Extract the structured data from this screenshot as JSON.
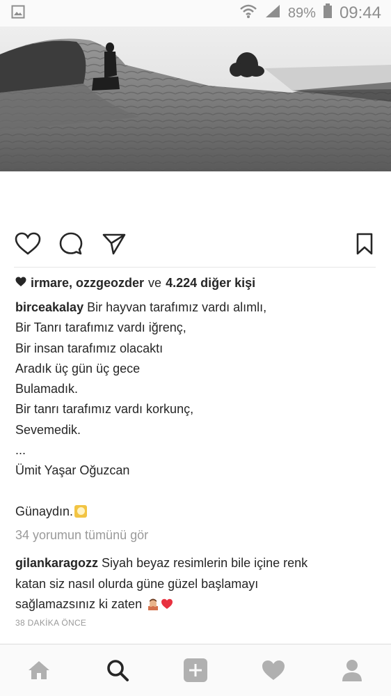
{
  "status_bar": {
    "battery": "89%",
    "time": "09:44",
    "icons": [
      "image-icon",
      "wifi-icon",
      "signal-icon",
      "battery-icon"
    ]
  },
  "post": {
    "likes": {
      "names": "irmare, ozzgeozder",
      "connector": "ve",
      "others": "4.224 diğer kişi"
    },
    "caption": {
      "username": "birceakalay",
      "first_line": "Bir hayvan tarafımız vardı alımlı,",
      "lines": [
        "Bir Tanrı tarafımız vardı iğrenç,",
        "Bir insan tarafımız olacaktı",
        "Aradık üç gün üç gece",
        "Bulamadık.",
        "Bir tanrı tarafımız vardı korkunç,",
        "Sevemedik.",
        "...",
        "Ümit Yaşar Oğuzcan"
      ],
      "greeting": "Günaydın."
    },
    "view_comments": "34 yorumun tümünü gör",
    "comment": {
      "username": "gilankaragozz",
      "first_line": "Siyah beyaz resimlerin bile içine renk",
      "line2": "katan siz nasıl olurda güne güzel başlamayı",
      "line3": "sağlamazsınız ki zaten"
    },
    "timestamp": "38 DAKİKA ÖNCE"
  },
  "actions": [
    "heart-icon",
    "comment-icon",
    "share-icon",
    "bookmark-icon"
  ],
  "tabbar": [
    "home-icon",
    "search-icon",
    "add-icon",
    "activity-icon",
    "profile-icon"
  ],
  "colors": {
    "text": "#262626",
    "muted": "#9a9a9a",
    "icon_inactive": "#b0b0b0",
    "heart_emoji": "#e8313f"
  }
}
